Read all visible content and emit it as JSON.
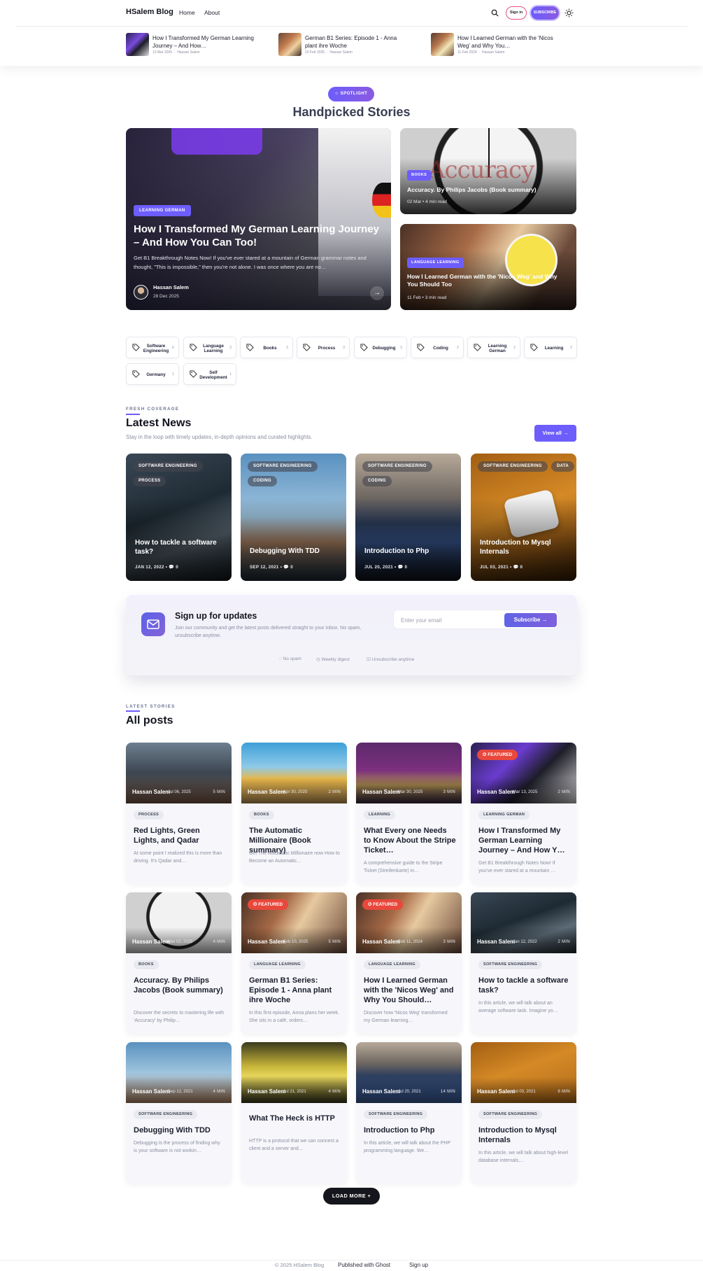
{
  "header": {
    "logo": "HSalem Blog",
    "nav": [
      "Home",
      "About"
    ],
    "signin": "Sign in",
    "subscribe": "SUBSCRIBE"
  },
  "ticker": [
    {
      "title": "How I Transformed My German Learning Journey – And How…",
      "date": "13 Mar 2025",
      "author": "Hassan Salem"
    },
    {
      "title": "German B1 Series: Episode 1 - Anna plant ihre Woche",
      "date": "10 Feb 2025",
      "author": "Hassan Salem"
    },
    {
      "title": "How I Learned German with the 'Nicos Weg' and Why You…",
      "date": "11 Feb 2024",
      "author": "Hassan Salem"
    }
  ],
  "spotlight": {
    "pill": "SPOTLIGHT",
    "title": "Handpicked Stories",
    "main": {
      "tag": "LEARNING GERMAN",
      "title": "How I Transformed My German Learning Journey – And How You Can Too!",
      "excerpt": "Get B1 Breakthrough Notes Now! If you've ever stared at a mountain of German grammar notes and thought, \"This is impossible,\" then you're not alone. I was once where you are no…",
      "author": "Hassan Salem",
      "date": "28 Dec 2025"
    },
    "side": [
      {
        "tag": "BOOKS",
        "title": "Accuracy. By Philips Jacobs (Book summary)",
        "meta": "02 Mar • 4 min read"
      },
      {
        "tag": "LANGUAGE LEARNING",
        "title": "How I Learned German with the 'Nicos Weg' and Why You Should Too",
        "meta": "11 Feb • 3 min read"
      }
    ]
  },
  "tags": [
    {
      "label": "Software Engineering",
      "count": "6"
    },
    {
      "label": "Language Learning",
      "count": "3"
    },
    {
      "label": "Books",
      "count": "3"
    },
    {
      "label": "Process",
      "count": "3"
    },
    {
      "label": "Debugging",
      "count": "3"
    },
    {
      "label": "Coding",
      "count": "2"
    },
    {
      "label": "Learning German",
      "count": "2"
    },
    {
      "label": "Learning",
      "count": "2"
    },
    {
      "label": "Germany",
      "count": "1"
    },
    {
      "label": "Self Development",
      "count": "1"
    }
  ],
  "latest": {
    "eyebrow": "FRESH COVERAGE",
    "title": "Latest News",
    "subtitle": "Stay in the loop with timely updates, in-depth opinions and curated highlights.",
    "view_all": "View all →",
    "cards": [
      {
        "tags": [
          "SOFTWARE ENGINEERING",
          "PROCESS"
        ],
        "title": "How to tackle a software task?",
        "meta": "JAN 12, 2022  •  💬 0"
      },
      {
        "tags": [
          "SOFTWARE ENGINEERING",
          "CODING"
        ],
        "title": "Debugging With TDD",
        "meta": "SEP 12, 2021  •  💬 0"
      },
      {
        "tags": [
          "SOFTWARE ENGINEERING",
          "CODING"
        ],
        "title": "Introduction to Php",
        "meta": "JUL 20, 2021  •  💬 0"
      },
      {
        "tags": [
          "SOFTWARE ENGINEERING",
          "DATA"
        ],
        "title": "Introduction to Mysql Internals",
        "meta": "JUL 03, 2021  •  💬 0"
      }
    ]
  },
  "newsletter": {
    "title": "Sign up for updates",
    "desc": "Join our community and get the latest posts delivered straight to your inbox. No spam, unsubscribe anytime.",
    "placeholder": "Enter your email",
    "button": "Subscribe",
    "features": [
      "No spam",
      "Weekly digest",
      "Unsubscribe anytime"
    ]
  },
  "allposts": {
    "eyebrow": "LATEST STORIES",
    "title": "All posts",
    "posts": [
      {
        "author": "Hassan Salem",
        "date": "Jul 06, 2025",
        "read": "5 MIN",
        "tag": "PROCESS",
        "title": "Red Lights, Green Lights, and Qadar",
        "excerpt": "At some point I realized this is more than driving. It's Qadar and…",
        "featured": ""
      },
      {
        "author": "Hassan Salem",
        "date": "Apr 30, 2025",
        "read": "2 MIN",
        "tag": "BOOKS",
        "title": "The Automatic Millionaire (Book summary)",
        "excerpt": "Get The Automatic Millionaire now How to Become an Automatic…",
        "featured": ""
      },
      {
        "author": "Hassan Salem",
        "date": "Mar 30, 2025",
        "read": "3 MIN",
        "tag": "LEARNING",
        "title": "What Every one Needs to Know About the Stripe Ticket…",
        "excerpt": "A comprehensive guide to the Stripe Ticket (Streifenkarte) in…",
        "featured": ""
      },
      {
        "author": "Hassan Salem",
        "date": "Mar 13, 2025",
        "read": "2 MIN",
        "tag": "LEARNING GERMAN",
        "title": "How I Transformed My German Learning Journey – And How Y…",
        "excerpt": "Get B1 Breakthrough Notes Now! If you've ever stared at a mountain …",
        "featured": "FEATURED"
      },
      {
        "author": "Hassan Salem",
        "date": "Mar 02, 2025",
        "read": "4 MIN",
        "tag": "BOOKS",
        "title": "Accuracy. By Philips Jacobs (Book summary)",
        "excerpt": "Discover the secrets to mastering life with 'Accuracy' by Philip…",
        "featured": ""
      },
      {
        "author": "Hassan Salem",
        "date": "Feb 10, 2025",
        "read": "5 MIN",
        "tag": "LANGUAGE LEARNING",
        "title": "German B1 Series: Episode 1 - Anna plant ihre Woche",
        "excerpt": "In this first episode, Anna plans her week. She sits in a café, orders…",
        "featured": "FEATURED"
      },
      {
        "author": "Hassan Salem",
        "date": "Feb 11, 2024",
        "read": "3 MIN",
        "tag": "LANGUAGE LEARNING",
        "title": "How I Learned German with the 'Nicos Weg' and Why You Should…",
        "excerpt": "Discover how 'Nicos Weg' transformed my German learning…",
        "featured": "FEATURED"
      },
      {
        "author": "Hassan Salem",
        "date": "Jan 12, 2022",
        "read": "2 MIN",
        "tag": "SOFTWARE ENGINEERING",
        "title": "How to tackle a software task?",
        "excerpt": "In this article, we will talk about an average software task. Imagine yo…",
        "featured": ""
      },
      {
        "author": "Hassan Salem",
        "date": "Sep 12, 2021",
        "read": "4 MIN",
        "tag": "SOFTWARE ENGINEERING",
        "title": "Debugging With TDD",
        "excerpt": "Debugging is the process of finding why is your software is not workin…",
        "featured": ""
      },
      {
        "author": "Hassan Salem",
        "date": "Jul 21, 2021",
        "read": "4 MIN",
        "tag": "",
        "title": "What The Heck is HTTP",
        "excerpt": "HTTP is a protocol that we can connect a client and a server and…",
        "featured": ""
      },
      {
        "author": "Hassan Salem",
        "date": "Jul 20, 2021",
        "read": "14 MIN",
        "tag": "SOFTWARE ENGINEERING",
        "title": "Introduction to Php",
        "excerpt": "In this article, we will talk about the PHP programming language. We…",
        "featured": ""
      },
      {
        "author": "Hassan Salem",
        "date": "Jul 03, 2021",
        "read": "6 MIN",
        "tag": "SOFTWARE ENGINEERING",
        "title": "Introduction to Mysql Internals",
        "excerpt": "In this article, we will talk about high-level database internals,…",
        "featured": ""
      }
    ],
    "load_more": "LOAD MORE  +"
  },
  "footer": {
    "copyright": "© 2025 HSalem Blog",
    "published": "Published with Ghost",
    "signup": "Sign up"
  },
  "colors": {
    "accent": "#6d5dfc",
    "featured": "#e9483c",
    "dark": "#15161c"
  }
}
